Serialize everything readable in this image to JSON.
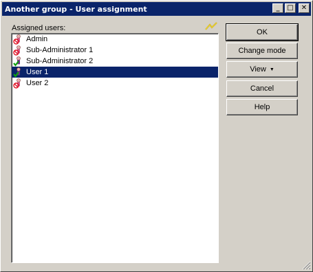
{
  "window": {
    "title": "Another group - User assignment",
    "minimize_glyph": "_",
    "maximize_glyph": "□",
    "close_glyph": "✕"
  },
  "assigned": {
    "label": "Assigned users:",
    "hint_icon": "lightning-icon"
  },
  "users": [
    {
      "name": "Admin",
      "icon": "user-denied-icon",
      "selected": false
    },
    {
      "name": "Sub-Administrator 1",
      "icon": "user-denied-icon",
      "selected": false
    },
    {
      "name": "Sub-Administrator 2",
      "icon": "user-allowed-icon",
      "selected": false
    },
    {
      "name": "User 1",
      "icon": "user-allowed-icon",
      "selected": true
    },
    {
      "name": "User 2",
      "icon": "user-denied-icon",
      "selected": false
    }
  ],
  "buttons": {
    "ok": "OK",
    "change_mode": "Change mode",
    "view": "View",
    "cancel": "Cancel",
    "help": "Help"
  },
  "colors": {
    "titlebar": "#0a246a",
    "selection": "#0a246a",
    "face": "#d4d0c8"
  }
}
